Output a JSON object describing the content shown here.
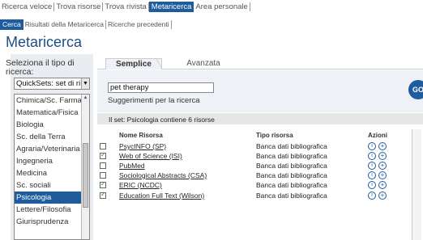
{
  "top_nav": [
    "Ricerca veloce",
    "Trova risorse",
    "Trova rivista",
    "Metaricerca",
    "Area personale"
  ],
  "top_nav_active": 3,
  "sub_nav": [
    "Cerca",
    "Risultati della Metaricerca",
    "Ricerche precedenti"
  ],
  "sub_nav_active": 0,
  "page_title": "Metaricerca",
  "sidebar": {
    "title": "Seleziona il tipo di ricerca:",
    "select_value": "QuickSets: set di ri",
    "items": [
      "Chimica/Sc. Farmaco",
      "Matematica/Fisica",
      "Biologia",
      "Sc. della Terra",
      "Agraria/Veterinaria",
      "Ingegneria",
      "Medicina",
      "Sc. sociali",
      "Psicologia",
      "Lettere/Filosofia",
      "Giurisprudenza"
    ],
    "selected_index": 8
  },
  "tabs": {
    "simple": "Semplice",
    "advanced": "Avanzata"
  },
  "search": {
    "value": "pet therapy",
    "suggest": "Suggerimenti per la ricerca",
    "go": "GO"
  },
  "set_info": "Il set: Psicologia contiene 6 risorse",
  "columns": {
    "name": "Nome Risorsa",
    "type": "Tipo risorsa",
    "actions": "Azioni"
  },
  "resources": [
    {
      "name": "PsycINFO (SP)",
      "type": "Banca dati bibliografica",
      "checked": false
    },
    {
      "name": "Web of Science (ISI)",
      "type": "Banca dati bibliografica",
      "checked": true
    },
    {
      "name": "PubMed",
      "type": "Banca dati bibliografica",
      "checked": false
    },
    {
      "name": "Sociological Abstracts (CSA)",
      "type": "Banca dati bibliografica",
      "checked": false
    },
    {
      "name": "ERIC (NCDC)",
      "type": "Banca dati bibliografica",
      "checked": true
    },
    {
      "name": "Education Full Text (Wilson)",
      "type": "Banca dati bibliografica",
      "checked": true
    }
  ],
  "icons": {
    "info": "info-icon",
    "add": "add-icon"
  },
  "colors": {
    "accent": "#1f5c9e",
    "title": "#1c4d87"
  }
}
